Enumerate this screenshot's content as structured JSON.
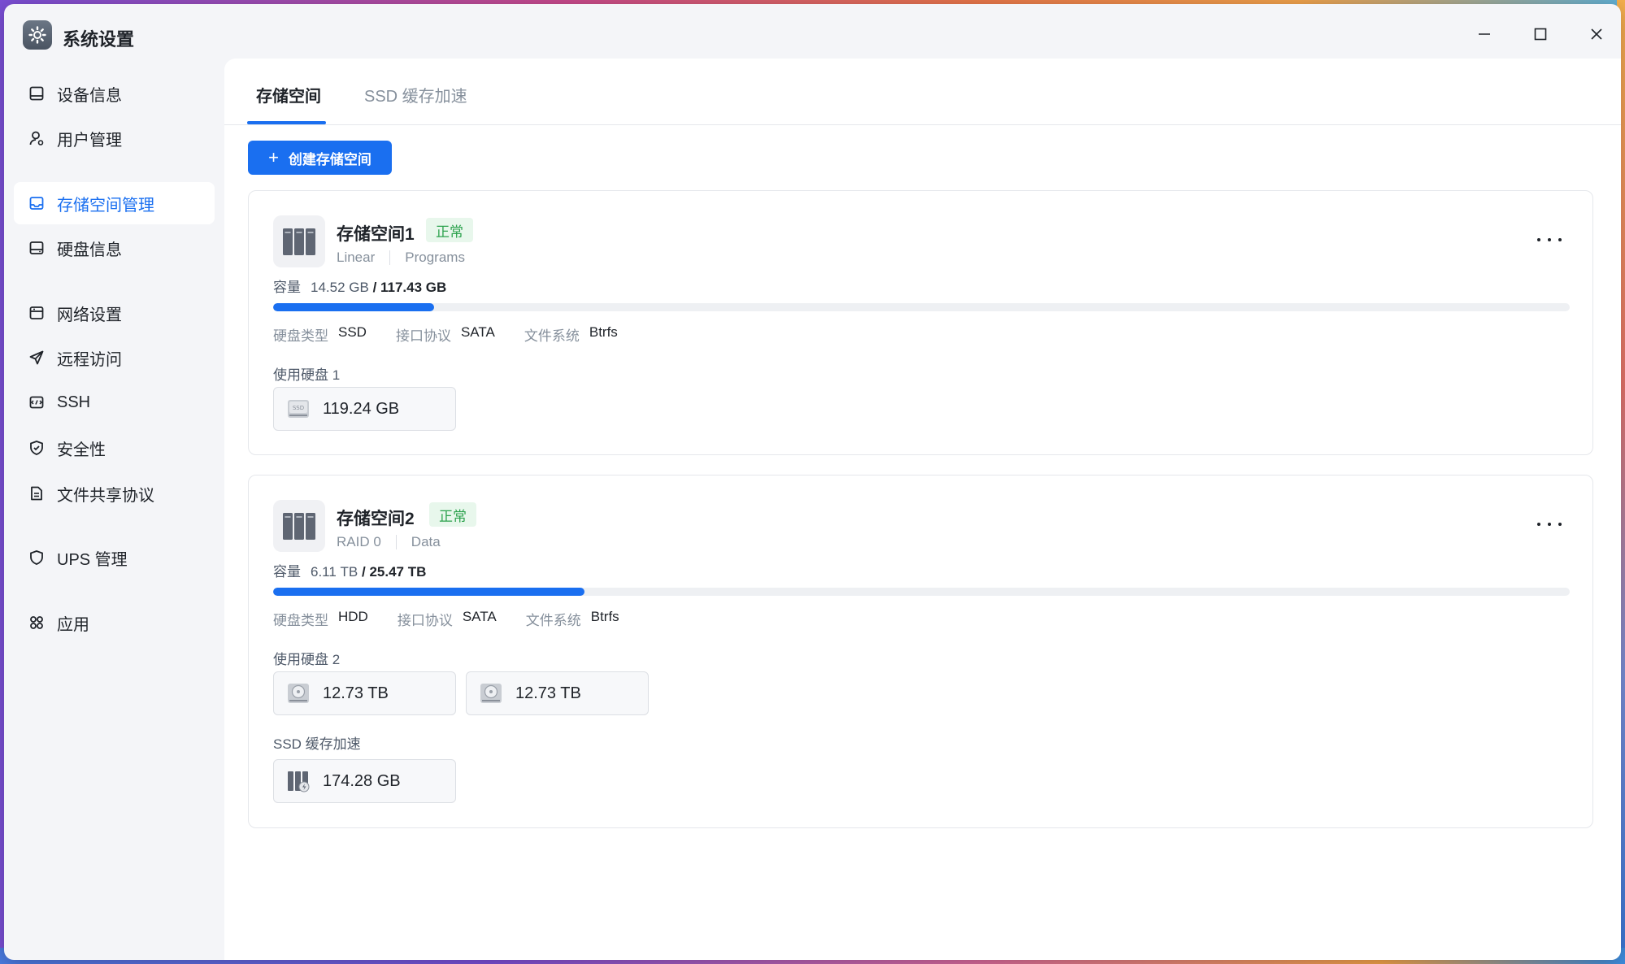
{
  "window": {
    "title": "系统设置",
    "app_icon": "gear-icon",
    "controls": [
      "minimize-icon",
      "maximize-icon",
      "close-icon"
    ]
  },
  "sidebar": {
    "items": [
      {
        "label": "设备信息",
        "icon": "device-icon",
        "active": false
      },
      {
        "label": "用户管理",
        "icon": "user-icon",
        "active": false
      },
      {
        "label": "存储空间管理",
        "icon": "storage-icon",
        "active": true
      },
      {
        "label": "硬盘信息",
        "icon": "disk-icon",
        "active": false
      },
      {
        "label": "网络设置",
        "icon": "network-icon",
        "active": false
      },
      {
        "label": "远程访问",
        "icon": "send-icon",
        "active": false
      },
      {
        "label": "SSH",
        "icon": "terminal-icon",
        "active": false
      },
      {
        "label": "安全性",
        "icon": "shield-check-icon",
        "active": false
      },
      {
        "label": "文件共享协议",
        "icon": "file-icon",
        "active": false
      },
      {
        "label": "UPS 管理",
        "icon": "shield-icon",
        "active": false
      },
      {
        "label": "应用",
        "icon": "apps-icon",
        "active": false
      }
    ]
  },
  "tabs": [
    {
      "label": "存储空间",
      "active": true
    },
    {
      "label": "SSD 缓存加速",
      "active": false
    }
  ],
  "create_button": {
    "label": "创建存储空间",
    "icon": "plus-icon"
  },
  "pools": [
    {
      "name": "存储空间1",
      "status": "正常",
      "raid": "Linear",
      "volume": "Programs",
      "capacity_label": "容量",
      "used": "14.52 GB",
      "total": "/ 117.43 GB",
      "usage_fraction": 0.124,
      "props": {
        "disk_type_label": "硬盘类型",
        "disk_type": "SSD",
        "protocol_label": "接口协议",
        "protocol": "SATA",
        "fs_label": "文件系统",
        "fs": "Btrfs"
      },
      "disks_label": "使用硬盘 1",
      "disks": [
        {
          "size": "119.24 GB",
          "icon": "ssd-icon"
        }
      ],
      "cache_label": null,
      "cache": []
    },
    {
      "name": "存储空间2",
      "status": "正常",
      "raid": "RAID 0",
      "volume": "Data",
      "capacity_label": "容量",
      "used": "6.11 TB",
      "total": "/ 25.47 TB",
      "usage_fraction": 0.24,
      "props": {
        "disk_type_label": "硬盘类型",
        "disk_type": "HDD",
        "protocol_label": "接口协议",
        "protocol": "SATA",
        "fs_label": "文件系统",
        "fs": "Btrfs"
      },
      "disks_label": "使用硬盘 2",
      "disks": [
        {
          "size": "12.73 TB",
          "icon": "hdd-icon"
        },
        {
          "size": "12.73 TB",
          "icon": "hdd-icon"
        }
      ],
      "cache_label": "SSD 缓存加速",
      "cache": [
        {
          "size": "174.28 GB",
          "icon": "ssd-cache-icon"
        }
      ]
    }
  ],
  "colors": {
    "accent": "#1a6ff0",
    "status_ok": "#2ca24d",
    "status_ok_bg": "#e8f7ec"
  }
}
